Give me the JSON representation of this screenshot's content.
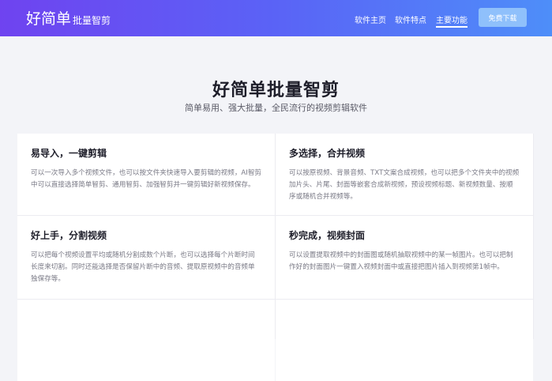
{
  "header": {
    "logo_main": "好简单",
    "logo_sub": "批量智剪",
    "nav": [
      "软件主页",
      "软件特点",
      "主要功能"
    ],
    "download_label": "免费下载",
    "active_nav": "主要功能"
  },
  "hero": {
    "title": "好简单批量智剪",
    "subtitle": "简单易用、强大批量，全民流行的视频剪辑软件"
  },
  "features": [
    {
      "title": "易导入，一键剪辑",
      "desc": "可以一次导入多个视频文件，也可以按文件夹快速导入要剪辑的视频，AI智剪中可以直接选择简单智剪、通用智剪、加强智剪并一键剪辑好新视频保存。"
    },
    {
      "title": "多选择，合并视频",
      "desc": "可以按原视频、背景音频、TXT文案合成视频，也可以把多个文件夹中的视频加片头、片尾、封面等嵌套合成新视频，预设视频标题、新视频数量、按顺序或随机合并视频等。"
    },
    {
      "title": "好上手，分割视频",
      "desc": "可以把每个视频设置平均或随机分割成数个片断，也可以选择每个片断时间长度来切割。同时还能选择是否保留片断中的音频、提取原视频中的音频单独保存等。"
    },
    {
      "title": "秒完成，视频封面",
      "desc": "可以设置提取视频中的封面图或随机抽取视频中的某一帧图片。也可以把制作好的封面图片一键置入视频封面中或直接把图片插入到视频第1帧中。"
    },
    {
      "title": "",
      "desc": ""
    },
    {
      "title": "",
      "desc": ""
    }
  ],
  "colors": {
    "header_gradient_start": "#6f43f0",
    "header_gradient_end": "#4e8ef9",
    "download_button": "#8fc0fb",
    "background": "#f3f4f8"
  }
}
